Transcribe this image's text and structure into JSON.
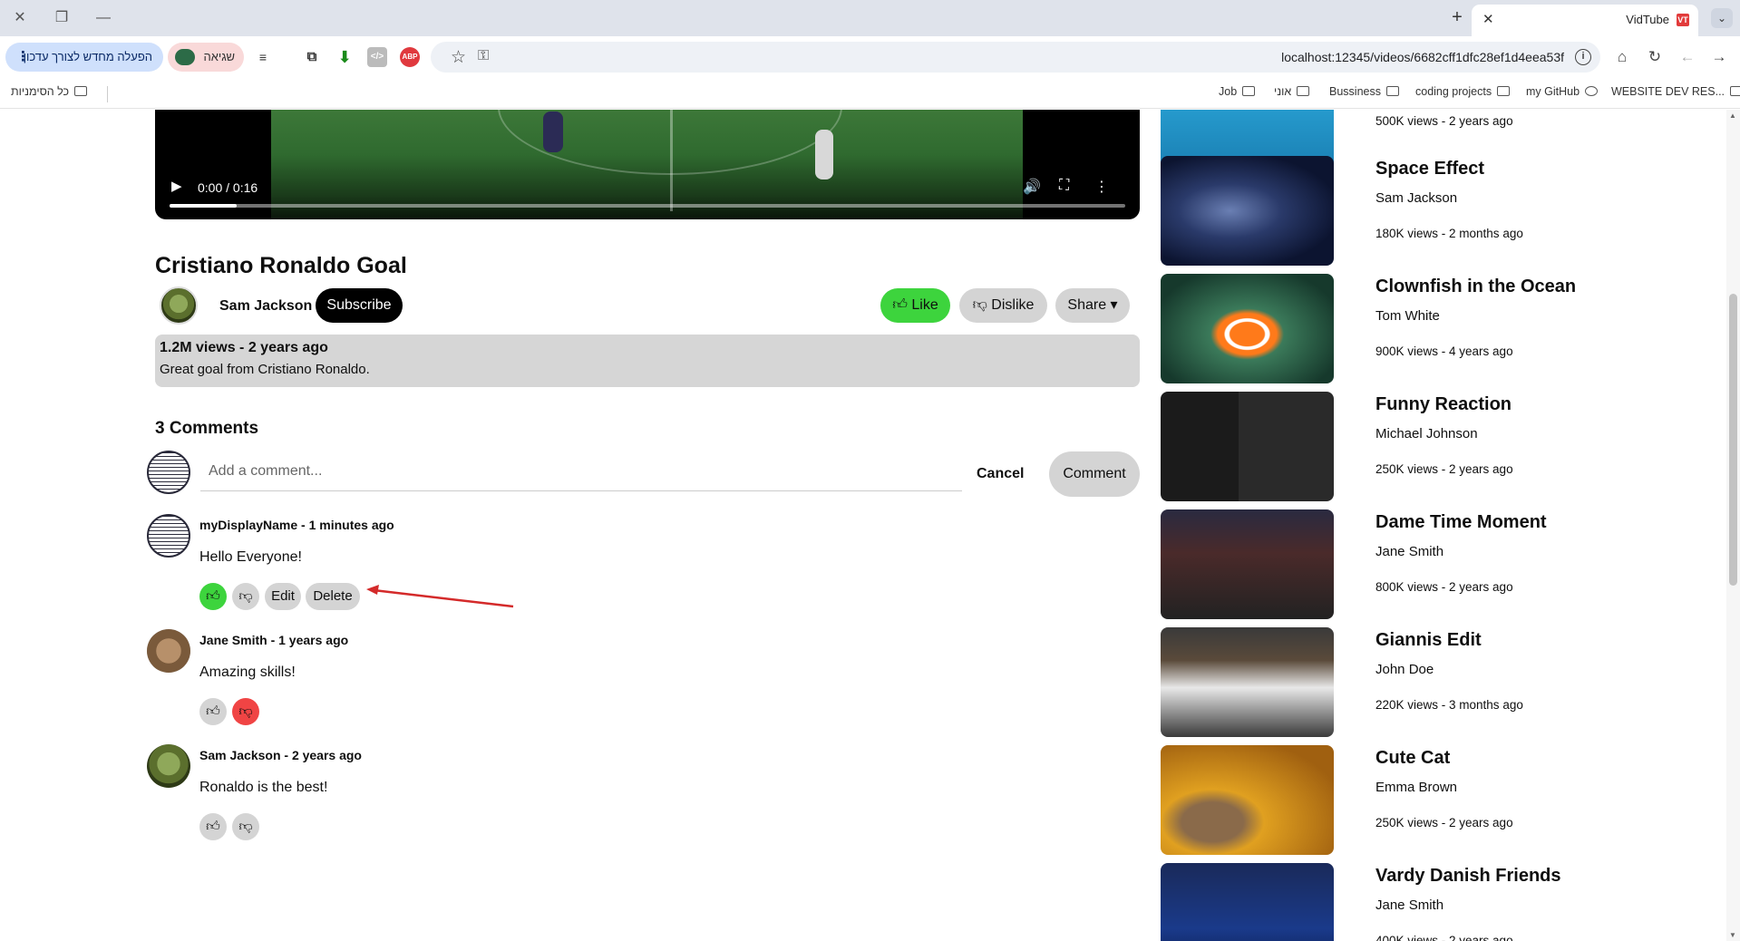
{
  "browser": {
    "tab_title": "VidTube",
    "tab_favicon": "VT",
    "url": "localhost:12345/videos/6682cff1dfc28ef1d4eea53f",
    "update_label": "הפעלה מחדש לצורך עדכון",
    "error_label": "שגיאה",
    "bookmarks": [
      "WEBSITE DEV RES...",
      "my GitHub",
      "coding projects",
      "Bussiness",
      "אוני",
      "Job"
    ],
    "all_bookmarks": "כל הסימניות"
  },
  "player": {
    "time": "0:00 / 0:16",
    "progress": 0.07
  },
  "video": {
    "title": "Cristiano Ronaldo Goal",
    "channel": "Sam Jackson",
    "subscribe_label": "Subscribe",
    "like_label": "Like",
    "dislike_label": "Dislike",
    "share_label": "Share",
    "meta": "1.2M views - 2 years ago",
    "description": "Great goal from Cristiano Ronaldo."
  },
  "comments": {
    "count_label": "3 Comments",
    "input_placeholder": "Add a comment...",
    "cancel_label": "Cancel",
    "submit_label": "Comment",
    "edit_label": "Edit",
    "delete_label": "Delete",
    "items": [
      {
        "meta": "myDisplayName - 1 minutes ago",
        "text": "Hello Everyone!",
        "liked": true,
        "disliked": false,
        "own": true
      },
      {
        "meta": "Jane Smith - 1 years ago",
        "text": "Amazing skills!",
        "liked": false,
        "disliked": true,
        "own": false
      },
      {
        "meta": "Sam Jackson - 2 years ago",
        "text": "Ronaldo is the best!",
        "liked": false,
        "disliked": false,
        "own": false
      }
    ]
  },
  "recommendations": {
    "top_meta": "500K views - 2 years ago",
    "items": [
      {
        "title": "Space Effect",
        "channel": "Sam Jackson",
        "meta": "180K views - 2 months ago"
      },
      {
        "title": "Clownfish in the Ocean",
        "channel": "Tom White",
        "meta": "900K views - 4 years ago"
      },
      {
        "title": "Funny Reaction",
        "channel": "Michael Johnson",
        "meta": "250K views - 2 years ago"
      },
      {
        "title": "Dame Time Moment",
        "channel": "Jane Smith",
        "meta": "800K views - 2 years ago"
      },
      {
        "title": "Giannis Edit",
        "channel": "John Doe",
        "meta": "220K views - 3 months ago"
      },
      {
        "title": "Cute Cat",
        "channel": "Emma Brown",
        "meta": "250K views - 2 years ago"
      },
      {
        "title": "Vardy Danish Friends",
        "channel": "Jane Smith",
        "meta": "400K views - 2 years ago"
      }
    ]
  },
  "colors": {
    "like_active": "#3dd43d",
    "dislike_active": "#f04444",
    "annotation_arrow": "#d42a2a"
  }
}
